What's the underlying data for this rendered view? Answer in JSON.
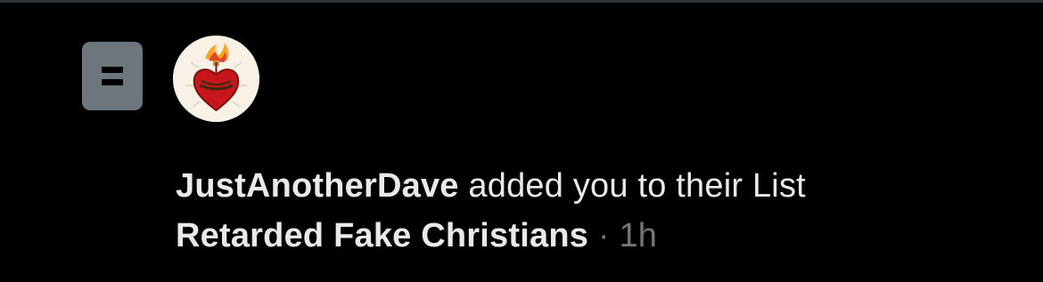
{
  "notification": {
    "type_icon": "list-icon",
    "avatar_icon": "sacred-heart-icon",
    "username": "JustAnotherDave",
    "action_text": " added you to their List",
    "list_name": "Retarded Fake Christians",
    "separator": " · ",
    "timestamp": "1h"
  },
  "colors": {
    "background": "#000000",
    "primary_text": "#e7e9ea",
    "secondary_text": "#71767b",
    "icon_gray": "#6e767d"
  }
}
